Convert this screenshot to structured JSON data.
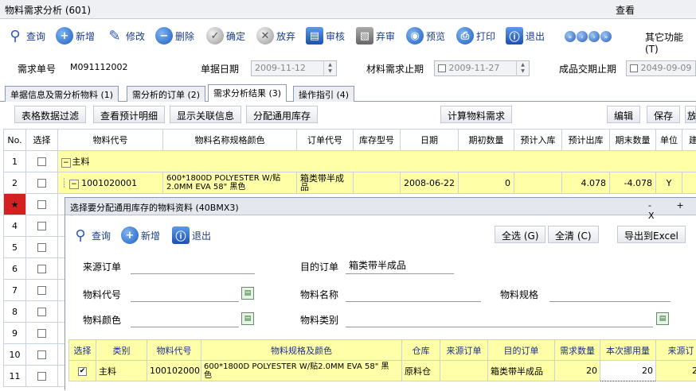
{
  "window": {
    "title": "物料需求分析 (601)",
    "view_menu": "查看"
  },
  "toolbar": {
    "query": "查询",
    "new": "新增",
    "edit": "修改",
    "delete": "删除",
    "confirm": "确定",
    "abandon": "放弃",
    "audit": "审核",
    "unaudit": "弃审",
    "preview": "预览",
    "print": "打印",
    "exit": "退出",
    "other": "其它功能 (T)"
  },
  "header": {
    "req_no_label": "需求单号",
    "req_no_value": "M091112002",
    "doc_date_label": "单据日期",
    "doc_date_value": "2009-11-12",
    "mat_deadline_label": "材料需求止期",
    "mat_deadline_value": "2009-11-27",
    "prod_deadline_label": "成品交期止期",
    "prod_deadline_value": "2049-09-09"
  },
  "tabs": [
    "单据信息及需分析物料 (1)",
    "需分析的订单 (2)",
    "需求分析结果 (3)",
    "操作指引 (4)"
  ],
  "buttons": {
    "filter": "表格数据过滤",
    "forecast": "查看预计明细",
    "related": "显示关联信息",
    "allocate": "分配通用库存",
    "calc": "计算物料需求",
    "edit": "编辑",
    "save": "保存",
    "more": "放"
  },
  "grid": {
    "columns": [
      "No.",
      "选择",
      "物料代号",
      "物料名称规格颜色",
      "订单代号",
      "库存型号",
      "日期",
      "期初数量",
      "预计入库",
      "预计出库",
      "期末数量",
      "单位",
      "建"
    ],
    "group_label": "主料",
    "row2": {
      "code": "1001020001",
      "name_line1": "600*1800D POLYESTER W/贴",
      "name_line2": "2.0MM EVA 58\" 黑色",
      "order": "箱类带半成品",
      "date": "2008-06-22",
      "opening": "0",
      "out": "4.078",
      "closing": "-4.078",
      "unit": "Y"
    },
    "row_numbers": [
      "1",
      "2",
      "★",
      "4",
      "5",
      "6",
      "7",
      "8",
      "9",
      "10",
      "11"
    ]
  },
  "dialog": {
    "title": "选择要分配通用库存的物料资料 (40BMX3)",
    "controls": "- + X",
    "query": "查询",
    "new": "新增",
    "exit": "退出",
    "select_all": "全选 (G)",
    "clear_all": "全清 (C)",
    "export": "导出到Excel",
    "src_order_label": "来源订单",
    "target_order_label": "目的订单",
    "target_order_value": "箱类带半成品",
    "mat_code_label": "物料代号",
    "mat_name_label": "物料名称",
    "mat_spec_label": "物料规格",
    "mat_color_label": "物料颜色",
    "mat_type_label": "物料类别",
    "columns": [
      "选择",
      "类别",
      "物料代号",
      "物料规格及颜色",
      "仓库",
      "来源订单",
      "目的订单",
      "需求数量",
      "本次挪用量",
      "来源订"
    ],
    "row": {
      "type": "主料",
      "code": "1001020001",
      "spec_line1": "600*1800D POLYESTER W/贴2.0MM EVA 58\" 黑",
      "spec_line2": "色",
      "warehouse": "原料仓",
      "target": "箱类带半成品",
      "qty": "20",
      "move_qty": "20",
      "src_more": "29"
    }
  }
}
